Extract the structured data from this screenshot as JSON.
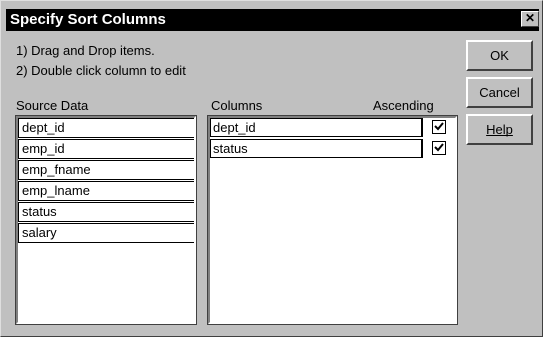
{
  "dialog": {
    "title": "Specify Sort Columns",
    "close_glyph": "✕"
  },
  "instructions": {
    "line1": "1) Drag and Drop items.",
    "line2": "2) Double click column to edit"
  },
  "source": {
    "header": "Source Data",
    "items": [
      "dept_id",
      "emp_id",
      "emp_fname",
      "emp_lname",
      "status",
      "salary"
    ]
  },
  "columns": {
    "header": "Columns",
    "ascending_header": "Ascending",
    "items": [
      {
        "name": "dept_id",
        "ascending": true
      },
      {
        "name": "status",
        "ascending": true
      }
    ]
  },
  "buttons": {
    "ok": "OK",
    "cancel": "Cancel",
    "help": "Help"
  }
}
